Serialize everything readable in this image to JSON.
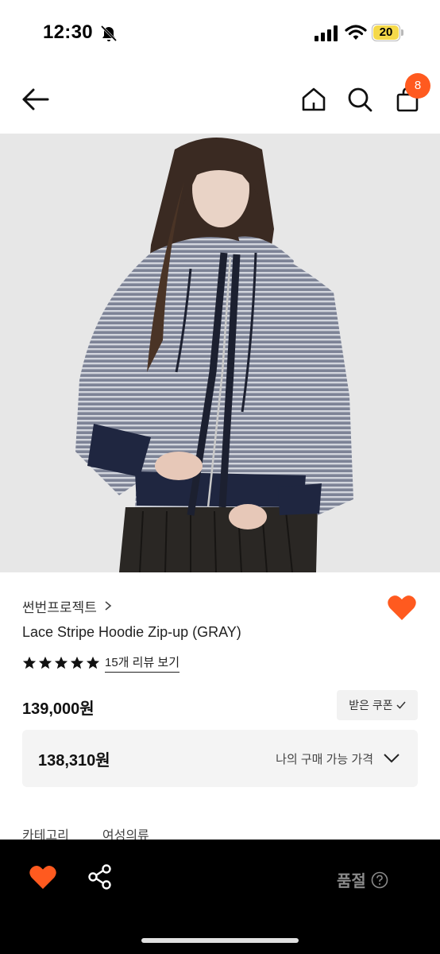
{
  "status_bar": {
    "time": "12:30",
    "battery": "20"
  },
  "nav": {
    "cart_count": "8"
  },
  "product": {
    "brand": "썬번프로젝트",
    "title": "Lace Stripe Hoodie Zip-up (GRAY)",
    "rating": 5,
    "review_link": "15개 리뷰 보기",
    "price": "139,000원",
    "coupon_label": "받은 쿠폰",
    "my_price": "138,310원",
    "my_price_label": "나의 구매 가능 가격",
    "category_label": "카테고리",
    "category_value": "여성의류"
  },
  "bottom_bar": {
    "status_label": "품절"
  },
  "colors": {
    "accent": "#ff5a1f",
    "bottom_bar": "#000000",
    "soldout_text": "#8a8a8a"
  },
  "icons": [
    "bell-off-icon",
    "signal-icon",
    "wifi-icon",
    "battery-icon",
    "back-arrow-icon",
    "home-icon",
    "search-icon",
    "bag-icon",
    "heart-icon",
    "star-icon",
    "chevron-right-icon",
    "check-icon",
    "chevron-down-icon",
    "share-icon",
    "help-icon"
  ]
}
